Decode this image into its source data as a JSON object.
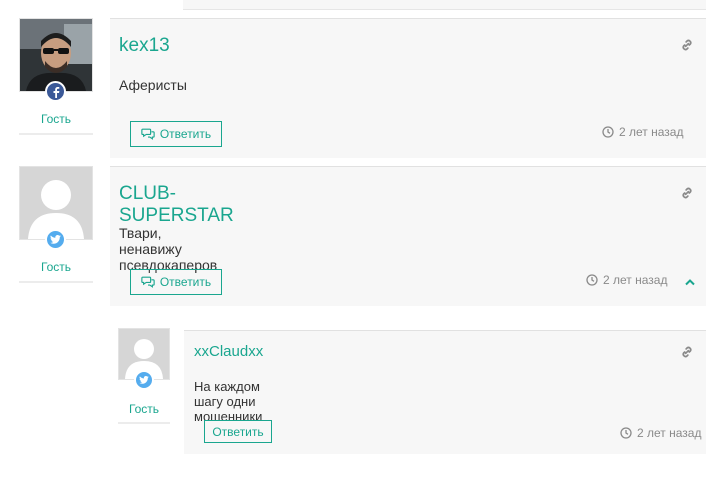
{
  "comments": [
    {
      "author": "kex13",
      "role": "Гость",
      "social": "facebook-icon",
      "text": "Аферисты",
      "reply_label": "Ответить",
      "time": "2 лет назад"
    },
    {
      "author": "CLUB-SUPERSTAR",
      "role": "Гость",
      "social": "twitter-icon",
      "text": "Твари, ненавижу псевдокаперов",
      "reply_label": "Ответить",
      "time": "2 лет назад",
      "toggle_icon": "chevron-up-icon"
    },
    {
      "author": "xxClaudxx",
      "role": "Гость",
      "social": "twitter-icon",
      "text": "На каждом шагу одни мошенники",
      "reply_label": "Ответить",
      "time": "2 лет назад"
    }
  ],
  "colors": {
    "accent": "#1aa68f",
    "facebook": "#3b5998",
    "twitter": "#55acee",
    "card_bg": "#f7f7f7",
    "muted": "#8a8a8a"
  }
}
